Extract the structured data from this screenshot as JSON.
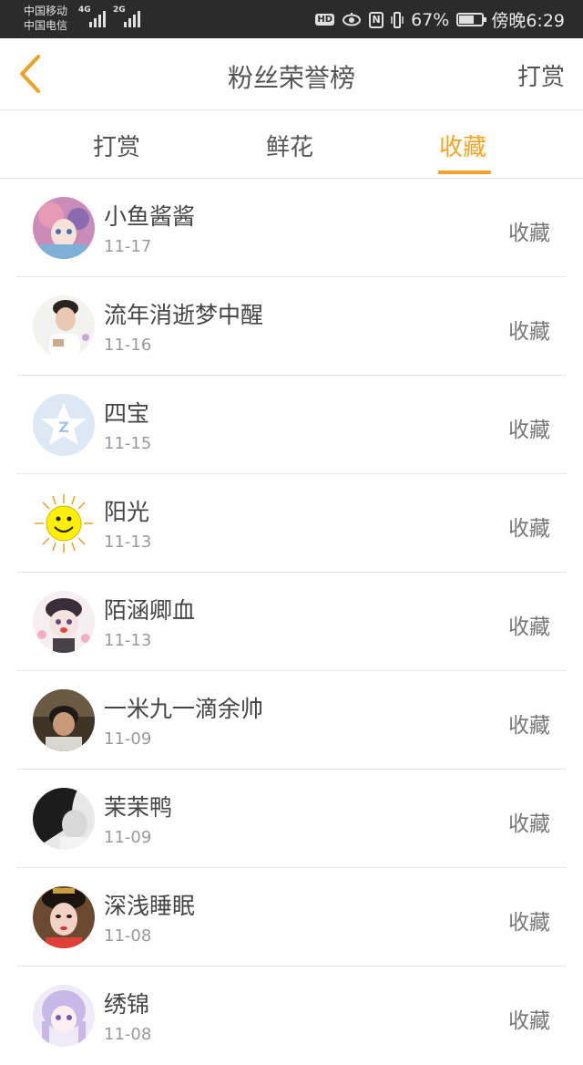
{
  "status_bar": {
    "carrier1": "中国移动",
    "carrier2": "中国电信",
    "net1": "4G",
    "net2": "2G",
    "hd": "HD",
    "nfc": "N",
    "battery_pct": "67%",
    "battery_level": 0.67,
    "time": "傍晚6:29"
  },
  "header": {
    "title": "粉丝荣誉榜",
    "reward_link": "打赏"
  },
  "tabs": [
    {
      "label": "打赏"
    },
    {
      "label": "鲜花"
    },
    {
      "label": "收藏"
    }
  ],
  "active_tab": 2,
  "colors": {
    "accent": "#f0a52a",
    "text": "#444444",
    "subtext": "#999999"
  },
  "fans": [
    {
      "name": "小鱼酱酱",
      "date": "11-17",
      "action": "收藏",
      "avatar": "anime-girl-pink-avatar"
    },
    {
      "name": "流年消逝梦中醒",
      "date": "11-16",
      "action": "收藏",
      "avatar": "young-man-photo-avatar"
    },
    {
      "name": "四宝",
      "date": "11-15",
      "action": "收藏",
      "avatar": "qzone-star-avatar"
    },
    {
      "name": "阳光",
      "date": "11-13",
      "action": "收藏",
      "avatar": "smiling-sun-avatar"
    },
    {
      "name": "陌涵卿血",
      "date": "11-13",
      "action": "收藏",
      "avatar": "anime-chibi-avatar"
    },
    {
      "name": "一米九一滴余帅",
      "date": "11-09",
      "action": "收藏",
      "avatar": "man-dark-photo-avatar"
    },
    {
      "name": "茉茉鸭",
      "date": "11-09",
      "action": "收藏",
      "avatar": "bw-girl-photo-avatar"
    },
    {
      "name": "深浅睡眠",
      "date": "11-08",
      "action": "收藏",
      "avatar": "costume-woman-avatar"
    },
    {
      "name": "绣锦",
      "date": "11-08",
      "action": "收藏",
      "avatar": "anime-purple-hair-avatar"
    }
  ]
}
